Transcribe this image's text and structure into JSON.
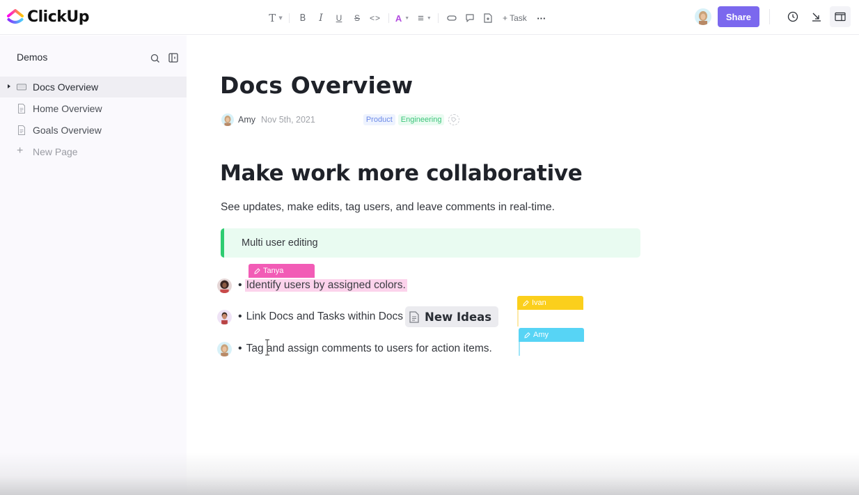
{
  "app": {
    "name": "ClickUp",
    "logo_gradient": [
      "#ff02f0",
      "#ffc800",
      "#8930fd",
      "#49ccf9"
    ]
  },
  "toolbar": {
    "items": [
      {
        "name": "text-style",
        "label": "T"
      },
      {
        "name": "bold",
        "label": "B"
      },
      {
        "name": "italic",
        "label": "I"
      },
      {
        "name": "underline",
        "label": "U"
      },
      {
        "name": "strikethrough",
        "label": "S"
      },
      {
        "name": "code",
        "label": "<>"
      },
      {
        "name": "text-color",
        "label": "A",
        "color": "#b44ee0"
      },
      {
        "name": "align",
        "label": "≡"
      },
      {
        "name": "link",
        "label": "link"
      },
      {
        "name": "comment",
        "label": "comment"
      },
      {
        "name": "embed-page",
        "label": "page"
      }
    ],
    "task_label": "+ Task",
    "more_label": "···"
  },
  "header_right": {
    "share_label": "Share",
    "share_color": "#7b68ee",
    "icons": [
      "clock-icon",
      "collapse-arrow-icon",
      "panel-layout-icon"
    ]
  },
  "sidebar": {
    "title": "Demos",
    "items": [
      {
        "label": "Docs Overview",
        "icon": "doc-keyboard-icon",
        "active": true,
        "expandable": true
      },
      {
        "label": "Home Overview",
        "icon": "page-icon",
        "active": false
      },
      {
        "label": "Goals Overview",
        "icon": "page-icon",
        "active": false
      }
    ],
    "new_page_label": "New Page"
  },
  "doc": {
    "title": "Docs Overview",
    "author": "Amy",
    "date": "Nov 5th, 2021",
    "tags": [
      {
        "label": "Product",
        "color": "#6c8ae8",
        "bg": "#eef3fe"
      },
      {
        "label": "Engineering",
        "color": "#3cc57a",
        "bg": "#eafbf1"
      }
    ],
    "heading": "Make work more collaborative",
    "lead": "See updates, make edits, tag users, and leave comments in real-time.",
    "callout": "Multi user editing",
    "callout_color": "#2ecc71",
    "bullets": [
      {
        "avatar": "Tanya",
        "text": "Identify users by assigned colors."
      },
      {
        "avatar": "Ivan",
        "text": "Link Docs and Tasks within Docs",
        "chip": "New Ideas"
      },
      {
        "avatar": "Amy",
        "text": "Tag and assign comments to users for action items."
      }
    ],
    "cursors": [
      {
        "user": "Tanya",
        "color": "#f25cb6"
      },
      {
        "user": "Ivan",
        "color": "#fbcf1c"
      },
      {
        "user": "Amy",
        "color": "#57d4f5"
      }
    ]
  }
}
